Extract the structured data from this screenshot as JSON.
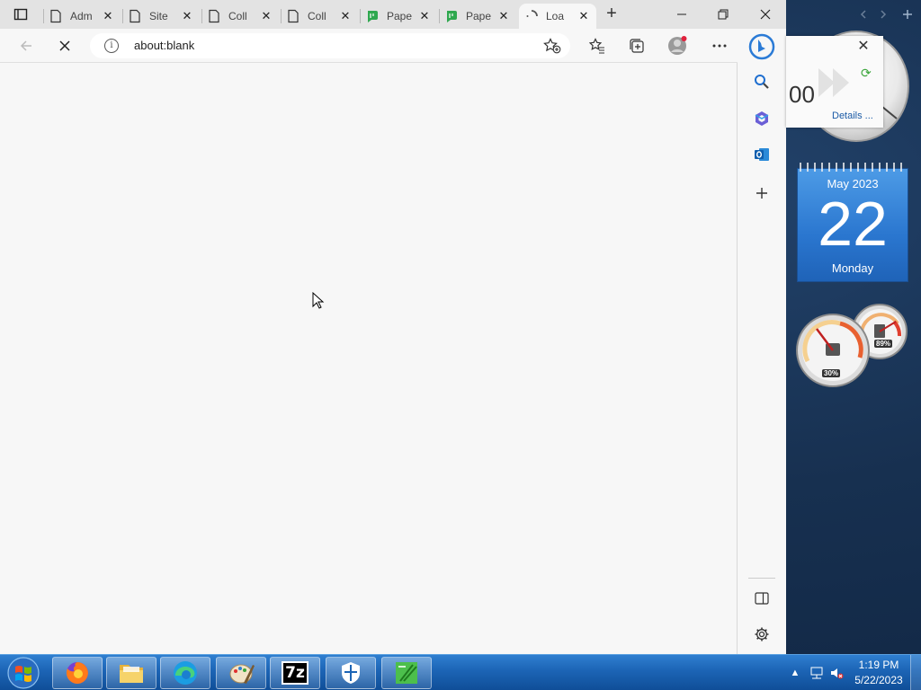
{
  "browser": {
    "tabs": [
      {
        "label": "Adm",
        "icon": "page-icon",
        "active": false
      },
      {
        "label": "Site",
        "icon": "page-icon",
        "active": false
      },
      {
        "label": "Coll",
        "icon": "page-icon",
        "active": false
      },
      {
        "label": "Coll",
        "icon": "page-icon",
        "active": false
      },
      {
        "label": "Pape",
        "icon": "paperclip-green-icon",
        "active": false
      },
      {
        "label": "Pape",
        "icon": "paperclip-green-icon",
        "active": false
      },
      {
        "label": "Loa",
        "icon": "loading-spinner-icon",
        "active": true
      }
    ],
    "new_tab_label": "+",
    "address": {
      "url": "about:blank"
    },
    "sidebar_icons": [
      "bing-icon",
      "search-icon",
      "office-icon",
      "outlook-icon",
      "add-icon",
      "sidebar-toggle-icon",
      "settings-icon"
    ]
  },
  "gadgets": {
    "popup": {
      "number": "00",
      "details_link": "Details ..."
    },
    "calendar": {
      "month_year": "May 2023",
      "day": "22",
      "weekday": "Monday"
    },
    "meters": {
      "cpu_label": "30%",
      "memory_label": "89%",
      "cpu": 30,
      "memory": 89
    }
  },
  "taskbar": {
    "apps": [
      "firefox-icon",
      "file-explorer-icon",
      "edge-icon",
      "paint-icon",
      "7zip-icon",
      "defender-icon",
      "paper-app-icon"
    ],
    "sevenzip_label": "7z",
    "time": "1:19 PM",
    "date": "5/22/2023",
    "colors": {
      "taskbar": "#1c64b5",
      "calendar": "#2a76cf"
    }
  }
}
